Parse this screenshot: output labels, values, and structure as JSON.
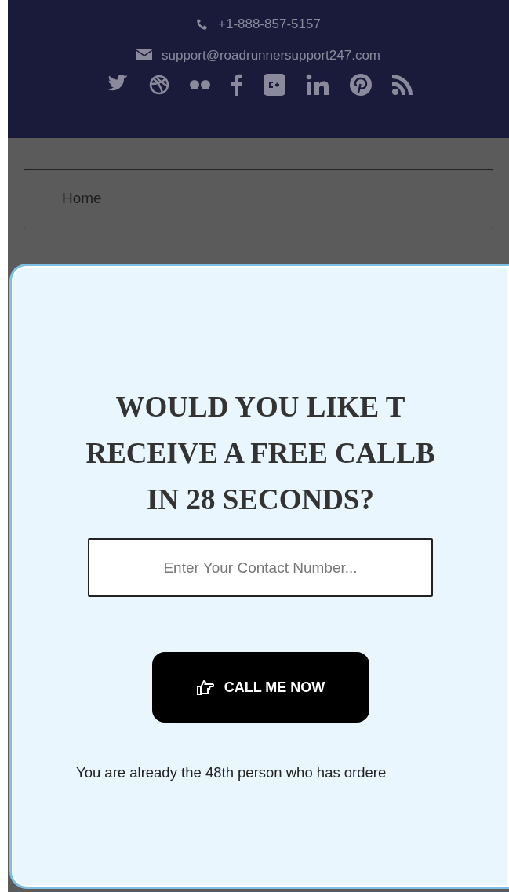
{
  "contact": {
    "phone": "+1-888-857-5157",
    "email": "support@roadrunnersupport247.com"
  },
  "nav": {
    "items": [
      {
        "label": "Home"
      }
    ]
  },
  "popup": {
    "heading_lines": [
      "WOULD YOU LIKE T",
      "RECEIVE A FREE CALLB",
      "IN 28 SECONDS?"
    ],
    "phone_field": {
      "placeholder": "Enter Your Contact Number..."
    },
    "button": "CALL ME NOW",
    "note": "You are already the 48th person who has ordere"
  }
}
